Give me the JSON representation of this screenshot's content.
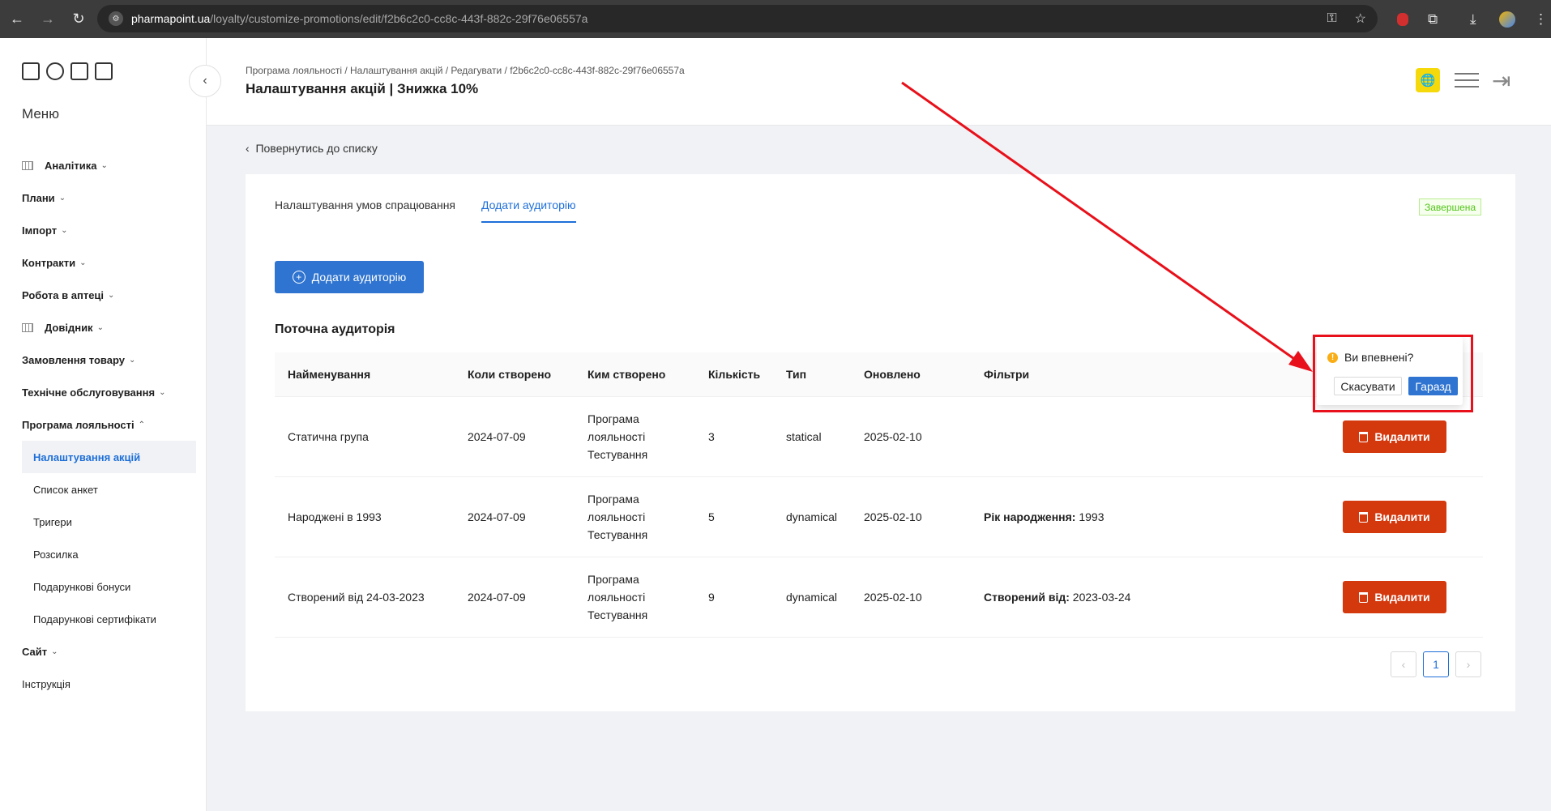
{
  "browser": {
    "url_host": "pharmapoint.ua",
    "url_path": "/loyalty/customize-promotions/edit/f2b6c2c0-cc8c-443f-882c-29f76e06557a"
  },
  "sidebar": {
    "menu_title": "Меню",
    "items": [
      {
        "label": "Аналітика",
        "chev": "⌄"
      },
      {
        "label": "Плани",
        "chev": "⌄"
      },
      {
        "label": "Імпорт",
        "chev": "⌄"
      },
      {
        "label": "Контракти",
        "chev": "⌄"
      },
      {
        "label": "Робота в аптеці",
        "chev": "⌄"
      },
      {
        "label": "Довідник",
        "chev": "⌄"
      },
      {
        "label": "Замовлення товару",
        "chev": "⌄"
      },
      {
        "label": "Технічне обслуговування",
        "chev": "⌄"
      },
      {
        "label": "Програма лояльності",
        "chev": "⌃"
      }
    ],
    "sub_items": [
      {
        "label": "Налаштування акцій"
      },
      {
        "label": "Список анкет"
      },
      {
        "label": "Тригери"
      },
      {
        "label": "Розсилка"
      },
      {
        "label": "Подарункові бонуси"
      },
      {
        "label": "Подарункові сертифікати"
      }
    ],
    "tail_items": [
      {
        "label": "Сайт",
        "chev": "⌄"
      },
      {
        "label": "Інструкція",
        "chev": ""
      }
    ]
  },
  "header": {
    "breadcrumb": "Програма лояльності / Налаштування акцій / Редагувати / f2b6c2c0-cc8c-443f-882c-29f76e06557a",
    "title": "Налаштування акцій | Знижка 10%"
  },
  "content": {
    "back_link": "Повернутись до списку",
    "tabs": [
      {
        "label": "Налаштування умов спрацювання"
      },
      {
        "label": "Додати аудиторію"
      }
    ],
    "status": "Завершена",
    "add_button": "Додати аудиторію",
    "section_title": "Поточна аудиторія",
    "table": {
      "headers": [
        "Найменування",
        "Коли створено",
        "Ким створено",
        "Кількість",
        "Тип",
        "Оновлено",
        "Фільтри"
      ],
      "rows": [
        {
          "name": "Статична група",
          "created": "2024-07-09",
          "author1": "Програма",
          "author2": "лояльності",
          "author3": "Тестування",
          "count": "3",
          "type": "statical",
          "updated": "2025-02-10",
          "filter_label": "",
          "filter_value": ""
        },
        {
          "name": "Народжені в 1993",
          "created": "2024-07-09",
          "author1": "Програма",
          "author2": "лояльності",
          "author3": "Тестування",
          "count": "5",
          "type": "dynamical",
          "updated": "2025-02-10",
          "filter_label": "Рік народження:",
          "filter_value": " 1993"
        },
        {
          "name": "Створений від 24-03-2023",
          "created": "2024-07-09",
          "author1": "Програма",
          "author2": "лояльності",
          "author3": "Тестування",
          "count": "9",
          "type": "dynamical",
          "updated": "2025-02-10",
          "filter_label": "Створений від:",
          "filter_value": " 2023-03-24"
        }
      ],
      "delete_label": "Видалити"
    },
    "pagination": {
      "current": "1"
    }
  },
  "popconfirm": {
    "message": "Ви впевнені?",
    "cancel": "Скасувати",
    "ok": "Гаразд"
  },
  "colors": {
    "primary": "#2f74d0",
    "danger": "#d4380d",
    "annotation": "#e8101a"
  }
}
